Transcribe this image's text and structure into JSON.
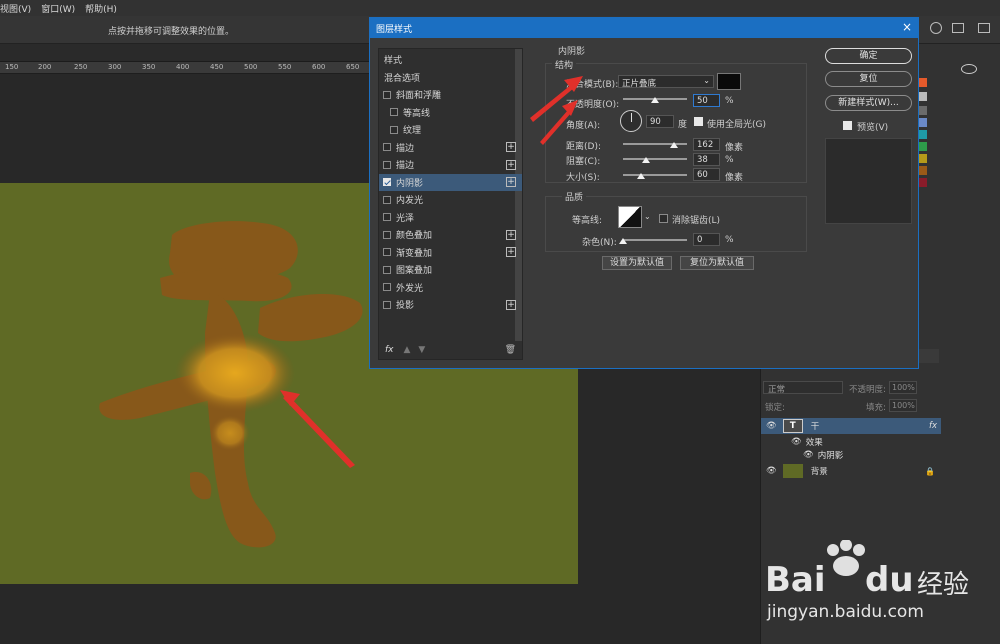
{
  "menu": [
    "视图(V)",
    "窗口(W)",
    "帮助(H)"
  ],
  "options_hint": "点按并拖移可调整效果的位置。",
  "ruler_labels": [
    "150",
    "200",
    "250",
    "300",
    "350",
    "400",
    "450",
    "500",
    "550",
    "600",
    "650"
  ],
  "dialog": {
    "title": "图层样式",
    "close": "×",
    "list_items": [
      {
        "label": "样式",
        "check": false,
        "has_check": false,
        "indent": 0,
        "plus": false,
        "selected": false
      },
      {
        "label": "混合选项",
        "check": false,
        "has_check": false,
        "indent": 0,
        "plus": false,
        "selected": false
      },
      {
        "label": "斜面和浮雕",
        "check": false,
        "has_check": true,
        "indent": 0,
        "plus": false,
        "selected": false
      },
      {
        "label": "等高线",
        "check": false,
        "has_check": true,
        "indent": 1,
        "plus": false,
        "selected": false
      },
      {
        "label": "纹理",
        "check": false,
        "has_check": true,
        "indent": 1,
        "plus": false,
        "selected": false
      },
      {
        "label": "描边",
        "check": false,
        "has_check": true,
        "indent": 0,
        "plus": true,
        "selected": false
      },
      {
        "label": "描边",
        "check": false,
        "has_check": true,
        "indent": 0,
        "plus": true,
        "selected": false
      },
      {
        "label": "内阴影",
        "check": true,
        "has_check": true,
        "indent": 0,
        "plus": true,
        "selected": true
      },
      {
        "label": "内发光",
        "check": false,
        "has_check": true,
        "indent": 0,
        "plus": false,
        "selected": false
      },
      {
        "label": "光泽",
        "check": false,
        "has_check": true,
        "indent": 0,
        "plus": false,
        "selected": false
      },
      {
        "label": "颜色叠加",
        "check": false,
        "has_check": true,
        "indent": 0,
        "plus": true,
        "selected": false
      },
      {
        "label": "渐变叠加",
        "check": false,
        "has_check": true,
        "indent": 0,
        "plus": true,
        "selected": false
      },
      {
        "label": "图案叠加",
        "check": false,
        "has_check": true,
        "indent": 0,
        "plus": false,
        "selected": false
      },
      {
        "label": "外发光",
        "check": false,
        "has_check": true,
        "indent": 0,
        "plus": false,
        "selected": false
      },
      {
        "label": "投影",
        "check": false,
        "has_check": true,
        "indent": 0,
        "plus": true,
        "selected": false
      }
    ],
    "fx_label": "fx",
    "section_title": "内阴影",
    "structure": "结构",
    "blend_mode_label": "混合模式(B):",
    "blend_mode_value": "正片叠底",
    "opacity_label": "不透明度(O):",
    "opacity_value": "50",
    "percent": "%",
    "angle_label": "角度(A):",
    "angle_value": "90",
    "degree": "度",
    "global_light": "使用全局光(G)",
    "distance_label": "距离(D):",
    "distance_value": "162",
    "choke_label": "阻塞(C):",
    "choke_value": "38",
    "size_label": "大小(S):",
    "size_value": "60",
    "pixel": "像素",
    "quality": "品质",
    "contour_label": "等高线:",
    "antialias": "消除锯齿(L)",
    "noise_label": "杂色(N):",
    "noise_value": "0",
    "set_default": "设置为默认值",
    "reset_default": "复位为默认值",
    "ok": "确定",
    "reset": "复位",
    "new_style": "新建样式(W)...",
    "preview": "预览(V)"
  },
  "layers": {
    "blend": "正常",
    "opacity_label": "不透明度:",
    "opacity": "100%",
    "lock_label": "锁定:",
    "fill_label": "填充:",
    "fill": "100%",
    "rows": [
      {
        "name": "干",
        "kind": "text"
      },
      {
        "name": "效果",
        "kind": "effects"
      },
      {
        "name": "内阴影",
        "kind": "effect"
      },
      {
        "name": "背景",
        "kind": "bg"
      }
    ],
    "fx": "fx"
  },
  "watermark": {
    "brand": "Bai",
    "brand2": "du",
    "cn": "经验",
    "url": "jingyan.baidu.com"
  },
  "colors": {
    "accent": "#1b6fc2",
    "artboard": "#5f6a25",
    "glyph": "#87581a",
    "highlight": "#e9a821"
  }
}
